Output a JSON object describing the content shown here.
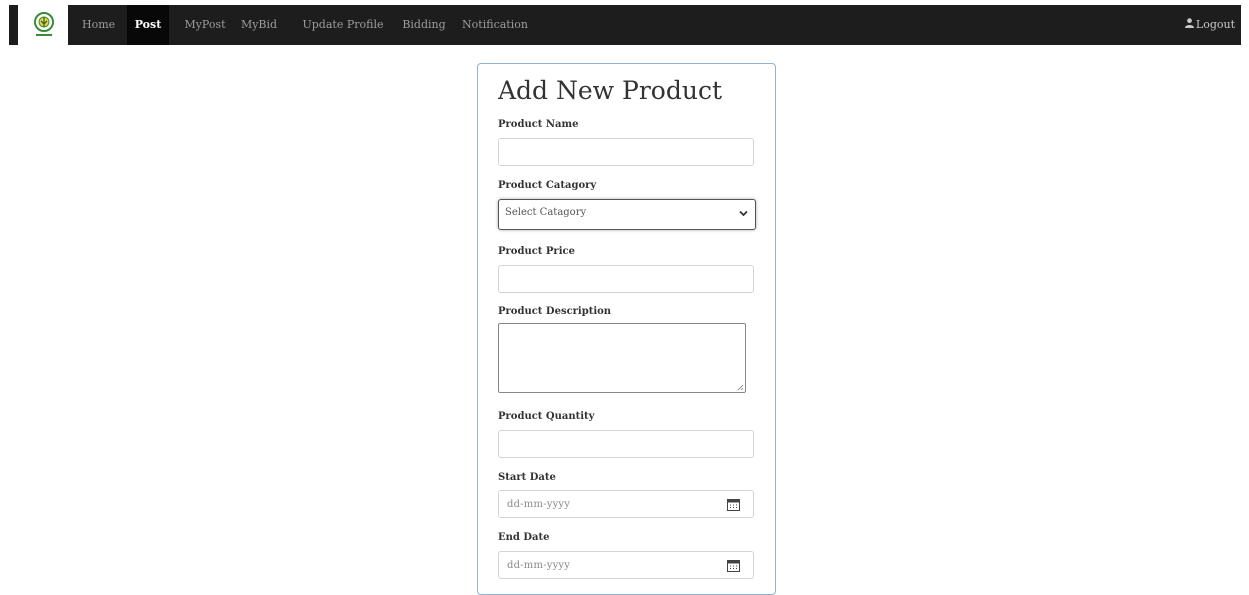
{
  "nav": {
    "items": [
      {
        "label": "Home"
      },
      {
        "label": "Post"
      },
      {
        "label": "MyPost"
      },
      {
        "label": "MyBid"
      },
      {
        "label": "Update Profile"
      },
      {
        "label": "Bidding"
      },
      {
        "label": "Notification"
      }
    ],
    "logout_label": "Logout"
  },
  "form": {
    "title": "Add New Product",
    "product_name_label": "Product Name",
    "product_name_value": "",
    "category_label": "Product Catagory",
    "category_selected": "Select Catagory",
    "price_label": "Product Price",
    "price_value": "",
    "description_label": "Product Description",
    "description_value": "",
    "quantity_label": "Product Quantity",
    "quantity_value": "",
    "start_date_label": "Start Date",
    "start_date_placeholder": "dd-mm-yyyy",
    "end_date_label": "End Date",
    "end_date_placeholder": "dd-mm-yyyy"
  }
}
